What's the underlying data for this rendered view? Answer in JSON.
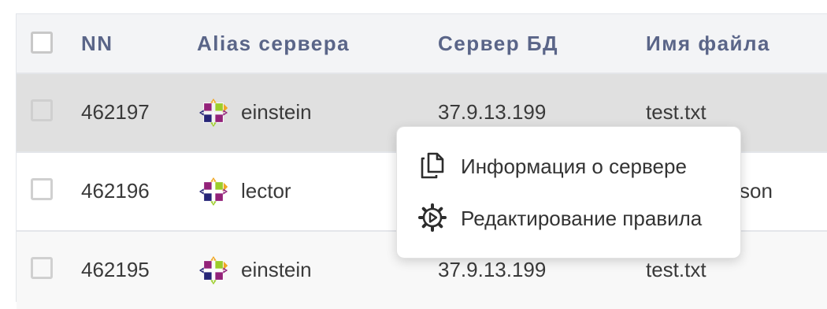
{
  "table": {
    "columns": [
      "NN",
      "Alias сервера",
      "Сервер БД",
      "Имя файла"
    ],
    "rows": [
      {
        "nn": "462197",
        "alias": "einstein",
        "server": "37.9.13.199",
        "file": "test.txt"
      },
      {
        "nn": "462196",
        "alias": "lector",
        "server": "",
        "file": "son"
      },
      {
        "nn": "462195",
        "alias": "einstein",
        "server": "37.9.13.199",
        "file": "test.txt"
      }
    ]
  },
  "context_menu": {
    "items": [
      {
        "label": "Информация о сервере",
        "icon": "copy-icon"
      },
      {
        "label": "Редактирование правила",
        "icon": "gear-icon"
      }
    ]
  },
  "icons": {
    "server_os": "centos-logo-icon"
  },
  "colors": {
    "header_text": "#5a6588",
    "header_bg": "#f3f4f6",
    "selected_row_bg": "#e0e0e0",
    "logo_purple": "#932279",
    "logo_yellow": "#efa724",
    "logo_green": "#9ccd2a",
    "logo_blue": "#262577"
  }
}
